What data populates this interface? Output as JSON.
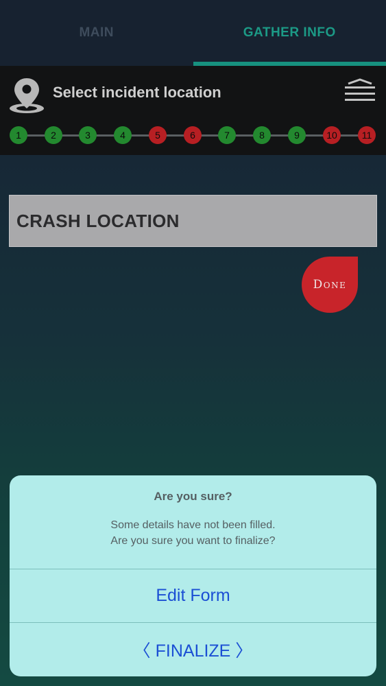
{
  "tabs": [
    {
      "label": "MAIN",
      "active": false
    },
    {
      "label": "GATHER INFO",
      "active": true
    }
  ],
  "header": {
    "title": "Select incident location",
    "icon": "location-pin-icon",
    "menu_icon": "hamburger-menu-icon"
  },
  "steps": [
    {
      "label": "1",
      "status": "complete"
    },
    {
      "label": "2",
      "status": "complete"
    },
    {
      "label": "3",
      "status": "complete"
    },
    {
      "label": "4",
      "status": "complete"
    },
    {
      "label": "5",
      "status": "incomplete"
    },
    {
      "label": "6",
      "status": "incomplete"
    },
    {
      "label": "7",
      "status": "complete"
    },
    {
      "label": "8",
      "status": "complete"
    },
    {
      "label": "9",
      "status": "complete"
    },
    {
      "label": "10",
      "status": "incomplete"
    },
    {
      "label": "11",
      "status": "incomplete"
    }
  ],
  "crash": {
    "label": "CRASH LOCATION"
  },
  "done_button": {
    "label": "Done"
  },
  "dialog": {
    "title": "Are you sure?",
    "message_line1": "Some details have not been filled.",
    "message_line2": "Are you sure you want to finalize?",
    "edit_label": "Edit Form",
    "finalize_label": "〈 FINALIZE 〉"
  },
  "colors": {
    "accent": "#17917f",
    "step_complete": "#23892f",
    "step_incomplete": "#b71f23",
    "done_button": "#c8242a",
    "dialog_button_text": "#1b4fd4"
  }
}
